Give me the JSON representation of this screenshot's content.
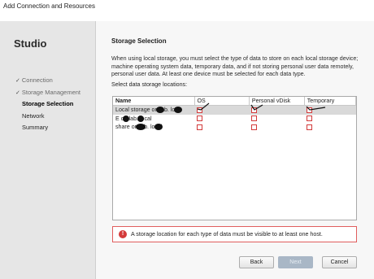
{
  "window": {
    "title": "Add Connection and Resources"
  },
  "sidebar": {
    "app_title": "Studio",
    "steps": [
      {
        "label": "Connection",
        "state": "done"
      },
      {
        "label": "Storage Management",
        "state": "done"
      },
      {
        "label": "Storage Selection",
        "state": "active"
      },
      {
        "label": "Network",
        "state": "future"
      },
      {
        "label": "Summary",
        "state": "future"
      }
    ],
    "check_glyph": "✓"
  },
  "main": {
    "title": "Storage Selection",
    "description": "When using local storage, you must select the type of data to store on each local storage device; machine operating system data, temporary data, and if not storing personal user data remotely, personal user data. At least one device must be selected for each data type.",
    "select_label": "Select data storage locations:",
    "table": {
      "columns": [
        "Name",
        "OS",
        "Personal vDisk",
        "Temporary"
      ],
      "rows": [
        {
          "name": "Local storage on  lab.  loca",
          "os": true,
          "pvd": true,
          "temp": true,
          "selected": true
        },
        {
          "name": "E on  lab.  local",
          "os": false,
          "pvd": false,
          "temp": false,
          "selected": false
        },
        {
          "name": "share on  lab.  local",
          "os": false,
          "pvd": false,
          "temp": false,
          "selected": false
        }
      ]
    },
    "error": {
      "icon": "!",
      "message": "A storage location for each type of data must be visible to at least one host."
    }
  },
  "footer": {
    "back_label": "Back",
    "next_label": "Next",
    "cancel_label": "Cancel"
  },
  "colors": {
    "error_red": "#d43b3b",
    "selected_row": "#d9d9d9",
    "next_disabled": "#a9b7c6"
  }
}
